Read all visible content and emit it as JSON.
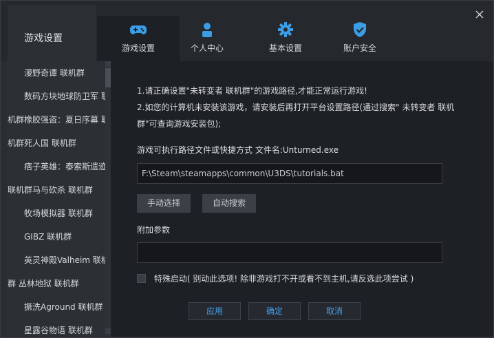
{
  "window": {
    "title": "游戏设置",
    "close_icon": "close-icon"
  },
  "tabs": [
    {
      "label": "游戏设置",
      "icon": "gamepad-icon",
      "active": true
    },
    {
      "label": "个人中心",
      "icon": "user-icon",
      "active": false
    },
    {
      "label": "基本设置",
      "icon": "gear-icon",
      "active": false
    },
    {
      "label": "账户安全",
      "icon": "shield-icon",
      "active": false
    }
  ],
  "sidebar": {
    "items": [
      {
        "label": "漫野奇谭 联机群"
      },
      {
        "label": "数码方块地球防卫军 联机群"
      },
      {
        "label": "机群橡胶强盗：夏日序幕 联机群"
      },
      {
        "label": "机群死人国 联机群"
      },
      {
        "label": "痞子英雄：泰索斯遗迹 联机群"
      },
      {
        "label": "联机群马与砍杀 联机群"
      },
      {
        "label": "牧场模拟器 联机群"
      },
      {
        "label": "GIBZ 联机群"
      },
      {
        "label": "英灵神殿Valheim 联机群"
      },
      {
        "label": "群  丛林地狱 联机群"
      },
      {
        "label": "撅洗Aground 联机群"
      },
      {
        "label": "星露谷物语 联机群"
      }
    ]
  },
  "main": {
    "message_line1": "1.请正确设置\"未转变者 联机群\"的游戏路径,才能正常运行游戏!",
    "message_line2": "2.如您的计算机未安装该游戏，请安装后再打开平台设置路径(通过搜索\" 未转变者 联机",
    "message_line3": "群\"可查询游戏安装包);",
    "path_label": "游戏可执行路径文件或快捷方式 文件名:Unturned.exe",
    "path_value": "F:\\Steam\\steamapps\\common\\U3DS\\tutorials.bat",
    "manual_select": "手动选择",
    "auto_search": "自动搜索",
    "param_label": "附加参数",
    "param_value": "",
    "special_launch": "特殊启动( 别动此选项! 除非游戏打不开或看不到主机,请反选此项尝试 )",
    "apply": "应用",
    "ok": "确定",
    "cancel": "取消"
  },
  "colors": {
    "accent": "#3fa0f2",
    "background": "#1d2024",
    "sidebar": "#2c3035"
  }
}
